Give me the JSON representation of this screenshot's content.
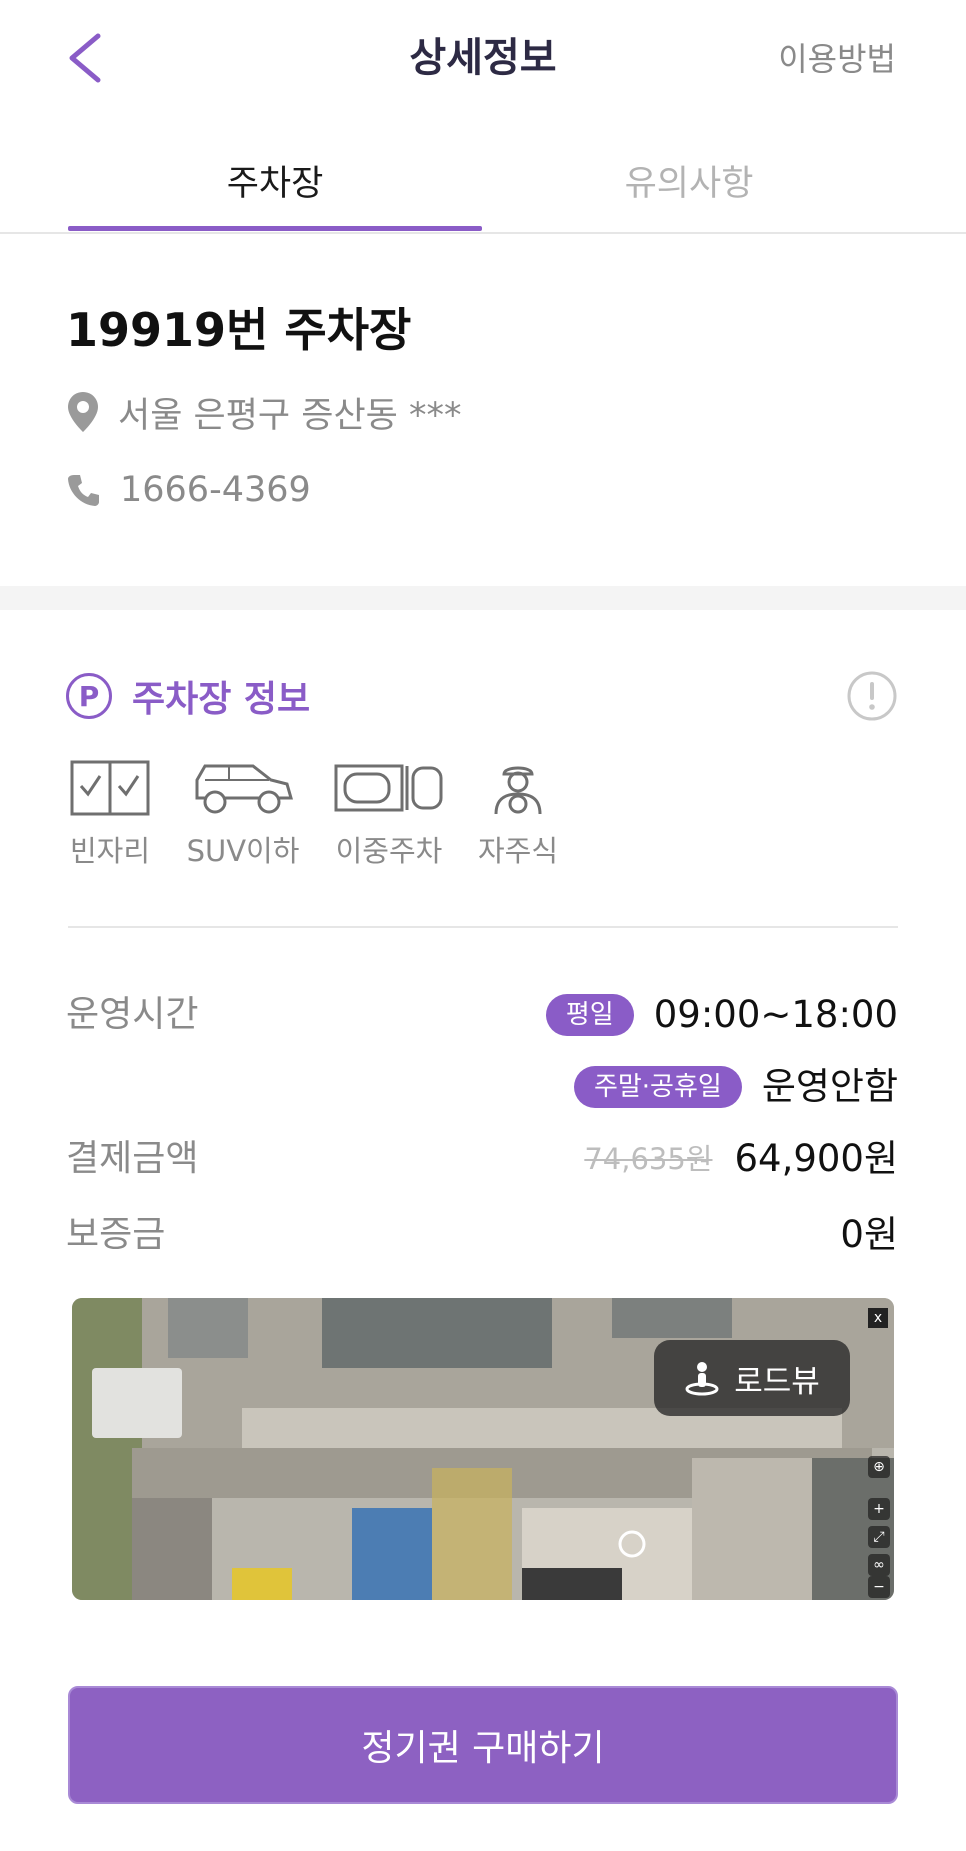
{
  "header": {
    "title": "상세정보",
    "help_link": "이용방법"
  },
  "tabs": [
    {
      "label": "주차장",
      "active": true
    },
    {
      "label": "유의사항",
      "active": false
    }
  ],
  "lot": {
    "name": "19919번 주차장",
    "address": "서울 은평구 증산동 ***",
    "phone": "1666-4369"
  },
  "parking_info": {
    "title": "주차장 정보",
    "badge_letter": "P",
    "features": [
      {
        "label": "빈자리",
        "icon": "checkbox-slots-icon"
      },
      {
        "label": "SUV이하",
        "icon": "suv-icon"
      },
      {
        "label": "이중주차",
        "icon": "double-parking-icon"
      },
      {
        "label": "자주식",
        "icon": "self-driver-icon"
      }
    ]
  },
  "details": {
    "hours_label": "운영시간",
    "weekday_badge": "평일",
    "weekday_hours": "09:00~18:00",
    "weekend_badge": "주말·공휴일",
    "weekend_hours": "운영안함",
    "price_label": "결제금액",
    "original_price": "74,635원",
    "price": "64,900원",
    "deposit_label": "보증금",
    "deposit": "0원"
  },
  "map": {
    "roadview_label": "로드뷰",
    "close_glyph": "x"
  },
  "cta": {
    "label": "정기권 구매하기"
  },
  "colors": {
    "accent": "#8a5cc7",
    "button": "#8d61c2",
    "muted_text": "#8a8a8a"
  }
}
